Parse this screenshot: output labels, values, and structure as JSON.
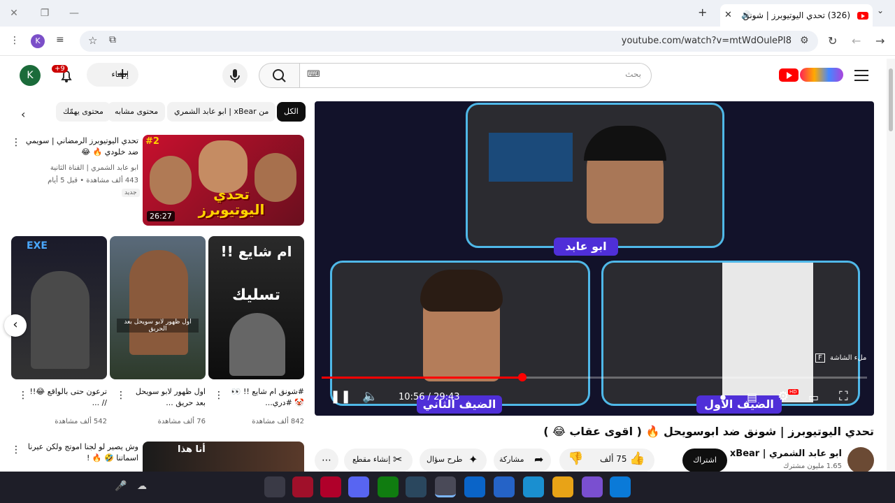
{
  "browser": {
    "tab_title": "(326) تحدي اليوتيوبرز | شونق",
    "url": "youtube.com/watch?v=mtWdOulePI8",
    "profile_initial": "K"
  },
  "header": {
    "search_placeholder": "بحث",
    "create_label": "إنشاء",
    "notifications_badge": "+9",
    "avatar_initial": "K"
  },
  "chips": [
    "الكل",
    "من xBear | ابو عابد الشمري",
    "محتوى مشابه",
    "محتوى يهمّك"
  ],
  "player": {
    "time": "10:56 / 29:43",
    "labels": [
      "ابو عابد",
      "الضيف الثاني",
      "الضيف الاول"
    ],
    "fullscreen_hint": "ملء الشاشة",
    "fullscreen_key": "F",
    "progress": 0.368,
    "hd_badge": "HD"
  },
  "video": {
    "title": "تحدي اليوتيوبرز | شونق ضد ابوسويحل 🔥 ( اقوى عقاب 😂 )",
    "channel": "ابو عابد الشمري | xBear",
    "subscribers": "1.65 مليون مشترك",
    "subscribe_label": "اشتراك",
    "likes": "75 ألف",
    "share_label": "مشاركة",
    "ask_label": "طرح سؤال",
    "clip_label": "إنشاء مقطع"
  },
  "sidebar": {
    "top_video": {
      "title": "تحدي اليوتيوبرز الرمضاني | سويمي ضد خلودي 🔥 😂",
      "channel": "ابو عابد الشمري | القناة الثانية",
      "meta": "443 ألف مشاهدة • قبل 5 أيام",
      "badge": "جديد",
      "duration": "26:27",
      "thumb_text": "تحدي اليوتيوبرز",
      "thumb_num": "#2"
    },
    "shorts": [
      {
        "title": "#شونق ام شايع !! 👀 🤡 #دري...",
        "views": "842 ألف مشاهدة",
        "overlay": "ام شايع !!",
        "overlay2": "تسليك"
      },
      {
        "title": "اول ظهور لابو سويحل بعد حريق ...",
        "views": "76 ألف مشاهدة",
        "overlay": "اول ظهور لابو سويحل بعد الحريق"
      },
      {
        "title": "ترعون حتى بالواقع 😂!! // ...",
        "views": "542 ألف مشاهدة",
        "overlay": "EXE"
      }
    ],
    "next_video": {
      "title": "وش يصير لو لجنا اموتج ولكن عيرنا اسماتنا 🤣 🔥 !",
      "thumb_text": "أنا هذا"
    }
  }
}
